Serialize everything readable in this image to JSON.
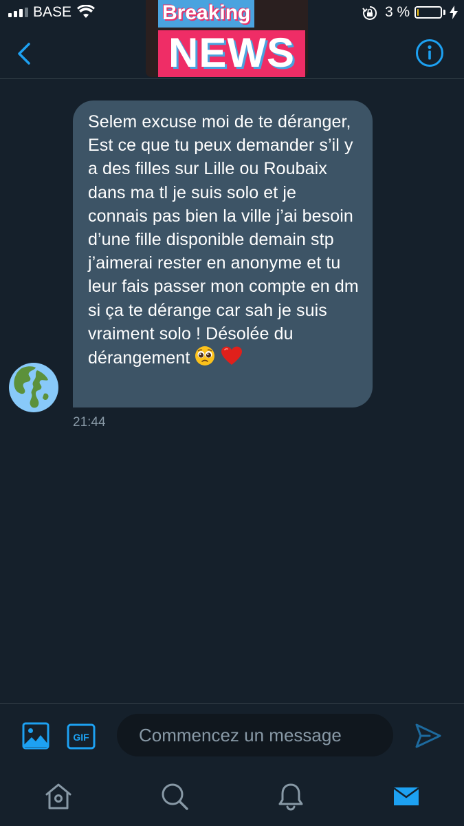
{
  "status_bar": {
    "carrier": "BASE",
    "battery_percent": "3 %",
    "battery_level": 0.03,
    "battery_color": "#f5c518"
  },
  "sticker": {
    "line1": "Breaking",
    "line2": "NEWS"
  },
  "header": {
    "back_icon": "chevron-left-icon",
    "info_icon": "info-circle-icon",
    "accent": "#1da1f2"
  },
  "conversation": {
    "messages": [
      {
        "text": "Selem excuse moi de te déranger, Est ce que tu peux demander s’il y a des filles sur Lille ou Roubaix dans ma tl je suis solo et je connais pas bien la ville j’ai besoin d’une fille disponible demain stp j’aimerai rester en anonyme et tu leur fais passer mon compte en dm si ça te dérange car sah je suis vraiment solo ! Désolée du dérangement",
        "emojis": [
          "pleading-face-icon",
          "red-heart-icon"
        ],
        "time": "21:44",
        "avatar": "globe-americas-icon",
        "bubble_color": "#3d5466"
      }
    ]
  },
  "composer": {
    "placeholder": "Commencez un message",
    "gif_label": "GIF",
    "icons": [
      "image-icon",
      "gif-icon",
      "send-icon"
    ]
  },
  "tabbar": {
    "tabs": [
      {
        "icon": "home-icon",
        "active": false
      },
      {
        "icon": "search-icon",
        "active": false
      },
      {
        "icon": "bell-icon",
        "active": false
      },
      {
        "icon": "envelope-icon",
        "active": true
      }
    ]
  },
  "colors": {
    "background": "#15202b",
    "muted": "#8899a6",
    "accent": "#1da1f2"
  }
}
